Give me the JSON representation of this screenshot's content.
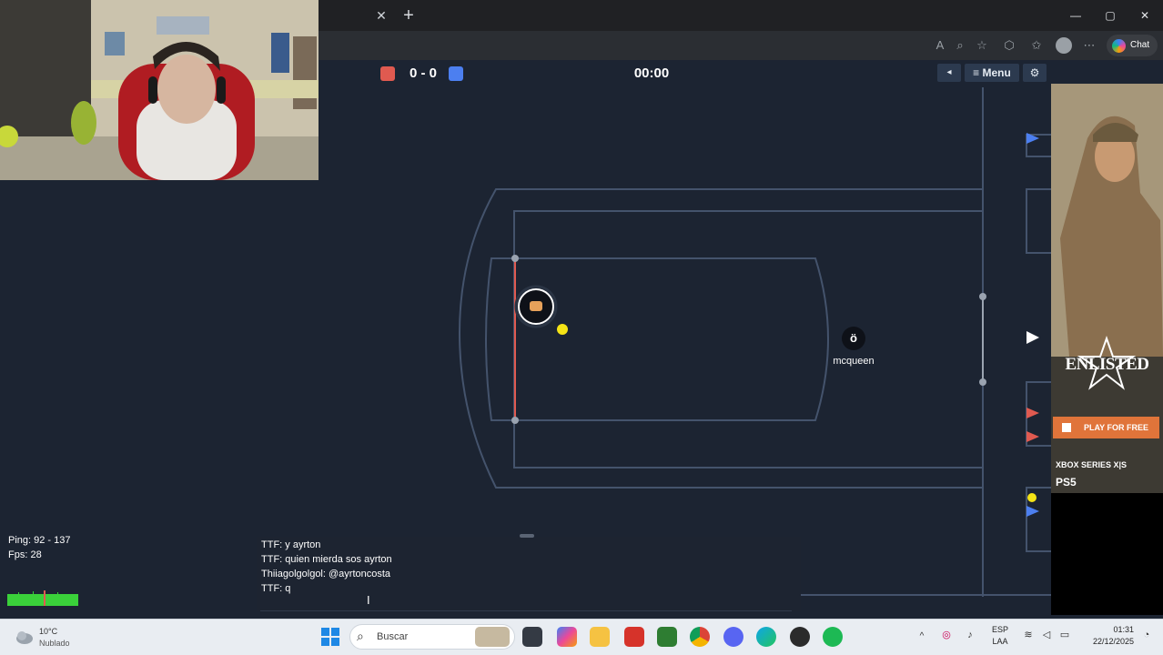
{
  "browser": {
    "tab_close_glyph": "✕",
    "new_tab_glyph": "+",
    "window_controls": [
      "—",
      "▢",
      "✕"
    ],
    "copilot_label": "Chat"
  },
  "game": {
    "score": "0 - 0",
    "red_score": 0,
    "blue_score": 0,
    "timer": "00:00",
    "menu_label": "Menu",
    "back_glyph": "◂",
    "menu_glyph": "≡",
    "gear_glyph": "⚙",
    "player_name": "mcqueen",
    "player_avatar": "ö",
    "colors": {
      "red_team": "#e05a50",
      "blue_team": "#4c7ff0",
      "field_line": "#44536c",
      "ball": "#f5e416",
      "background": "#1c2432"
    }
  },
  "stats": {
    "ping": "Ping: 92 - 137",
    "fps": "Fps: 28"
  },
  "chat": {
    "messages": [
      "TTF: y ayrton",
      "TTF: quien mierda sos ayrton",
      "Thiiagolgolgol: @ayrtoncosta",
      "TTF: q"
    ]
  },
  "ad": {
    "title": "ENLISTED",
    "cta": "PLAY FOR FREE",
    "platform1": "XBOX SERIES X|S",
    "platform2": "PS5"
  },
  "taskbar": {
    "weather_temp": "10°C",
    "weather_condition": "Nublado",
    "search_placeholder": "Buscar",
    "language": "ESP",
    "language_sub": "LAA",
    "time": "01:31",
    "date": "22/12/2025"
  }
}
